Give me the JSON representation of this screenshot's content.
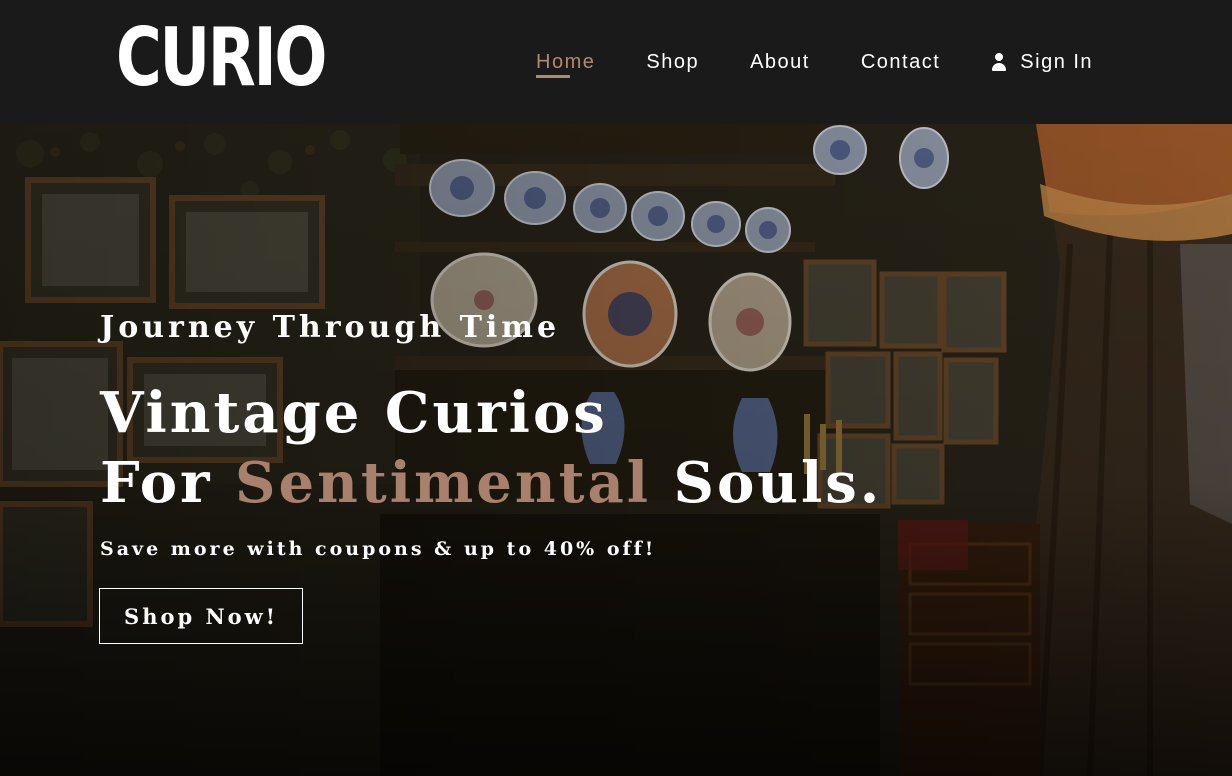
{
  "brand": {
    "logo_text": "CURIO"
  },
  "nav": {
    "items": [
      {
        "label": "Home",
        "active": true
      },
      {
        "label": "Shop",
        "active": false
      },
      {
        "label": "About",
        "active": false
      },
      {
        "label": "Contact",
        "active": false
      }
    ],
    "signin_label": "Sign In",
    "signin_icon": "user-icon"
  },
  "hero": {
    "eyebrow": "Journey Through Time",
    "headline_line1": "Vintage Curios",
    "headline_line2_prefix": "For ",
    "headline_line2_accent": "Sentimental",
    "headline_line2_suffix": " Souls.",
    "subline": "Save more with coupons & up to 40% off!",
    "cta_label": "Shop Now!"
  },
  "colors": {
    "header_bg": "#1a1a1a",
    "accent": "#a8806d",
    "text": "#ffffff"
  }
}
